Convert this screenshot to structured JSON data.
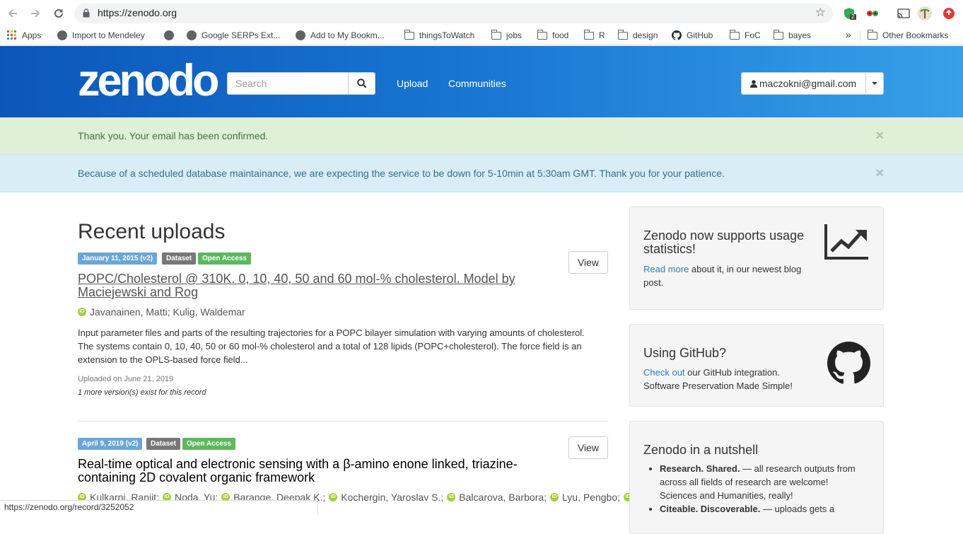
{
  "browser": {
    "url": "https://zenodo.org",
    "ext_badge_count": "2",
    "bookmarks": [
      {
        "label": "Apps",
        "kind": "apps"
      },
      {
        "label": "Import to Mendeley",
        "kind": "globe"
      },
      {
        "label": "",
        "kind": "globe"
      },
      {
        "label": "Google SERPs Ext...",
        "kind": "globe"
      },
      {
        "label": "Add to My Bookm...",
        "kind": "globe"
      },
      {
        "label": "thingsToWatch",
        "kind": "folder"
      },
      {
        "label": "jobs",
        "kind": "folder"
      },
      {
        "label": "food",
        "kind": "folder"
      },
      {
        "label": "R",
        "kind": "folder"
      },
      {
        "label": "design",
        "kind": "folder"
      },
      {
        "label": "GitHub",
        "kind": "github"
      },
      {
        "label": "FoC",
        "kind": "folder"
      },
      {
        "label": "bayes",
        "kind": "folder"
      }
    ],
    "overflow": "»",
    "other_bookmarks": "Other Bookmarks",
    "status_url": "https://zenodo.org/record/3252052"
  },
  "header": {
    "logo": "zenodo",
    "search_placeholder": "Search",
    "nav": [
      "Upload",
      "Communities"
    ],
    "user_email": "maczokni@gmail.com"
  },
  "alerts": {
    "success": "Thank you. Your email has been confirmed.",
    "info": "Because of a scheduled database maintainance, we are expecting the service to be down for 5-10min at 5:30am GMT. Thank you for your patience.",
    "close": "×"
  },
  "main": {
    "heading": "Recent uploads",
    "view_label": "View",
    "records": [
      {
        "date_badge": "January 11, 2015 (v2)",
        "type_badge": "Dataset",
        "access_badge": "Open Access",
        "title": "POPC/Cholesterol @ 310K. 0, 10, 40, 50 and 60 mol-% cholesterol. Model by Maciejewski and Rog",
        "authors": "Javanainen, Matti; Kulig, Waldemar",
        "description": "Input parameter files and parts of the resulting trajectories for a POPC bilayer simulation with varying amounts of cholesterol. The systems contain 0, 10, 40, 50 or 60 mol-% cholesterol and a total of 128 lipids (POPC+cholesterol). The force field is an extension to the OPLS-based force field...",
        "uploaded": "Uploaded on June 21, 2019",
        "versions": "1 more version(s) exist for this record"
      },
      {
        "date_badge": "April 9, 2019 (v2)",
        "type_badge": "Dataset",
        "access_badge": "Open Access",
        "title": "Real-time optical and electronic sensing with a β-amino enone linked, triazine-containing 2D covalent organic framework",
        "authors": [
          "Kulkarni, Ranjit;",
          "Noda, Yu;",
          "Barange, Deepak K.;",
          "Kochergin, Yaroslav S.;",
          "Balcarova, Barbora;",
          "Lyu, Pengbo;",
          ""
        ]
      }
    ]
  },
  "sidebar": {
    "stats": {
      "title": "Zenodo now supports usage statistics!",
      "link": "Read more",
      "text": " about it, in our newest blog post."
    },
    "github": {
      "title": "Using GitHub?",
      "link": "Check out",
      "text": " our GitHub integration. Software Preservation Made Simple!"
    },
    "nutshell": {
      "title": "Zenodo in a nutshell",
      "items": [
        {
          "bold": "Research. Shared.",
          "text": " — all research outputs from across all fields of research are welcome! Sciences and Humanities, really!"
        },
        {
          "bold": "Citeable. Discoverable.",
          "text": " — uploads gets a"
        }
      ]
    }
  },
  "colors": {
    "header_start": "#0b57b9",
    "header_end": "#37a0e8",
    "success_bg": "#dff0d8",
    "info_bg": "#d9edf7",
    "link": "#337ab7",
    "open_access": "#5cb85c"
  }
}
